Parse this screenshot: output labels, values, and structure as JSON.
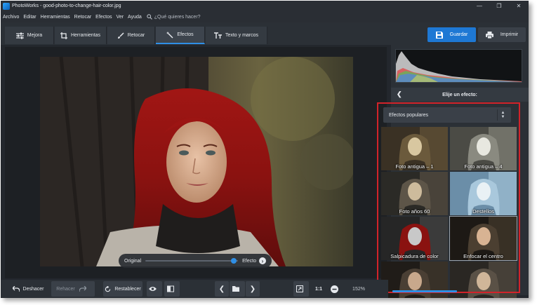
{
  "window": {
    "title": "PhotoWorks - good-photo-to-change-hair-color.jpg"
  },
  "menu": {
    "items": [
      "Archivo",
      "Editar",
      "Herramientas",
      "Retocar",
      "Efectos",
      "Ver",
      "Ayuda"
    ],
    "search_placeholder": "¿Qué quieres hacer?"
  },
  "tabs": [
    {
      "label": "Mejora",
      "icon": "sliders-icon"
    },
    {
      "label": "Herramientas",
      "icon": "crop-icon"
    },
    {
      "label": "Retocar",
      "icon": "brush-icon"
    },
    {
      "label": "Efectos",
      "icon": "magic-wand-icon",
      "active": true
    },
    {
      "label": "Texto y marcos",
      "icon": "text-icon"
    }
  ],
  "actions": {
    "save_label": "Guardar",
    "print_label": "Imprimir"
  },
  "compare": {
    "original_label": "Original",
    "effect_label": "Efecto",
    "slider_position": 0.95
  },
  "effects_panel": {
    "header": "Elije un efecto:",
    "category": "Efectos populares",
    "effects": [
      {
        "label": "Foto antigua – 1",
        "style": "vintage"
      },
      {
        "label": "Foto antigua – 4",
        "style": "vintage-light"
      },
      {
        "label": "Foto años 60",
        "style": "sixties"
      },
      {
        "label": "Destellos",
        "style": "flares"
      },
      {
        "label": "Salpicadura de color",
        "style": "color-splash"
      },
      {
        "label": "Enfocar el centro",
        "style": "focus-center",
        "selected": true
      },
      {
        "label": "",
        "style": "dark"
      },
      {
        "label": "",
        "style": "dark-light"
      }
    ]
  },
  "bottombar": {
    "undo_label": "Deshacer",
    "redo_label": "Rehacer",
    "reset_label": "Restablecer",
    "ratio_label": "1:1",
    "zoom": "152%"
  },
  "colors": {
    "accent": "#1e78d4",
    "highlight_frame": "#d2232a",
    "background": "#23272d"
  }
}
